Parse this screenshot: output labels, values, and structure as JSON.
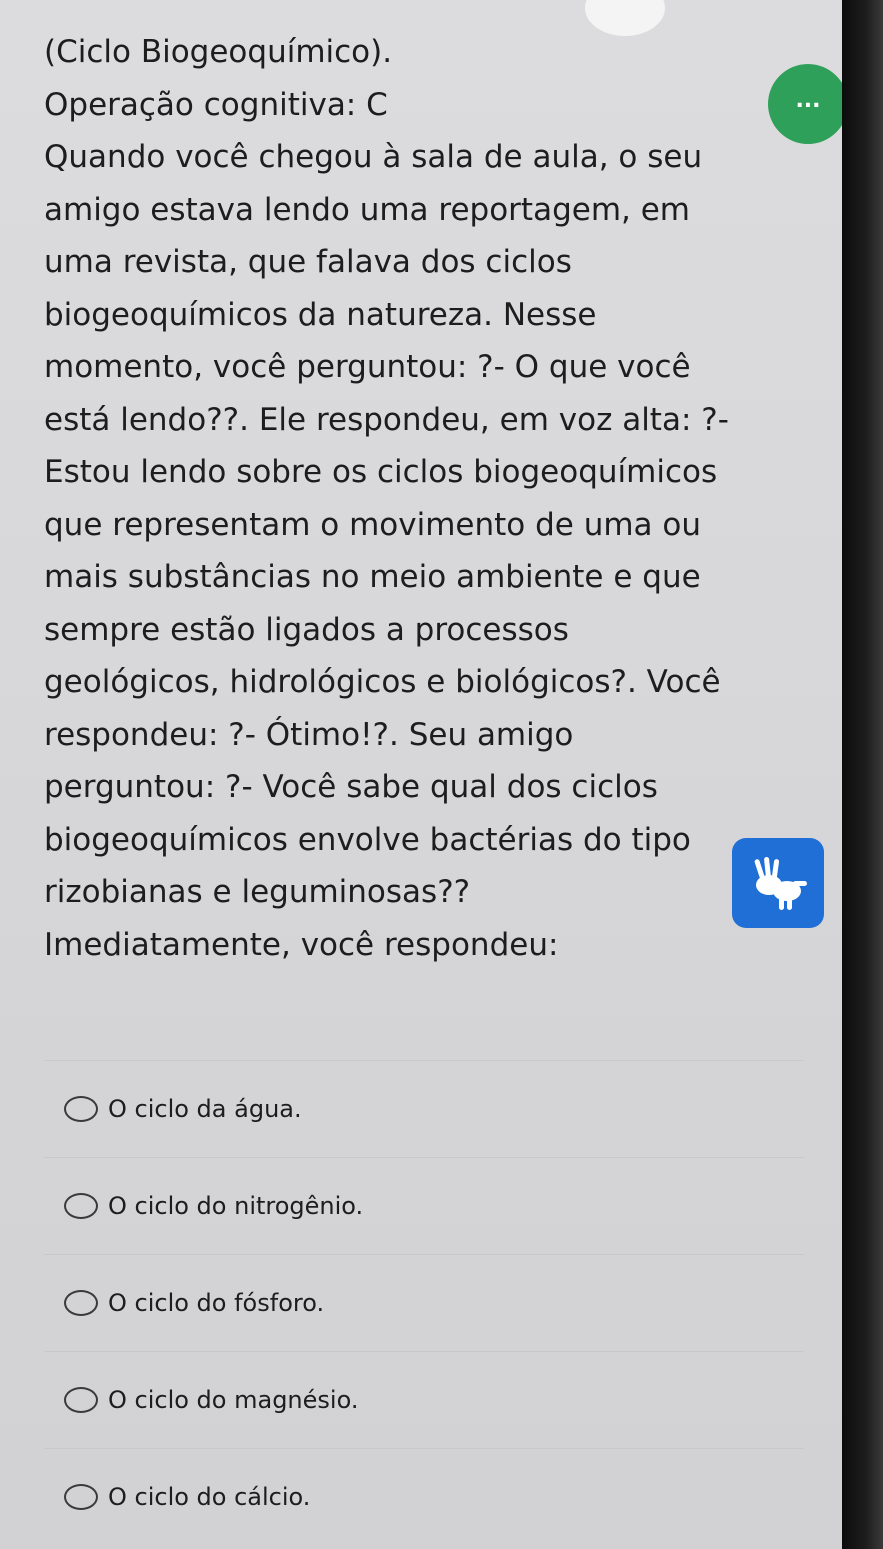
{
  "question": {
    "lines": [
      "(Ciclo Biogeoquímico).",
      "Operação cognitiva: C",
      "Quando você chegou à sala de aula, o seu",
      "amigo estava lendo uma reportagem, em",
      "uma revista, que falava dos ciclos",
      "biogeoquímicos da natureza. Nesse",
      "momento, você perguntou: ?- O que você",
      "está lendo??. Ele respondeu, em voz alta: ?-",
      "Estou lendo sobre os ciclos biogeoquímicos",
      "que representam o movimento de uma ou",
      "mais substâncias no meio ambiente e que",
      "sempre estão ligados a processos",
      "geológicos, hidrológicos e biológicos?. Você",
      "respondeu: ?- Ótimo!?. Seu amigo",
      "perguntou: ?- Você sabe qual dos ciclos",
      "biogeoquímicos envolve bactérias do tipo",
      "rizobianas e leguminosas??",
      "Imediatamente, você respondeu:"
    ]
  },
  "more_button": {
    "label": "...",
    "color": "#2fa05a"
  },
  "libras_button": {
    "icon": "sign-language-hands-icon",
    "color": "#1f6fd6"
  },
  "options": [
    {
      "label": "O ciclo da água."
    },
    {
      "label": "O ciclo do nitrogênio."
    },
    {
      "label": "O ciclo do fósforo."
    },
    {
      "label": "O ciclo do magnésio."
    },
    {
      "label": "O ciclo do cálcio."
    }
  ]
}
